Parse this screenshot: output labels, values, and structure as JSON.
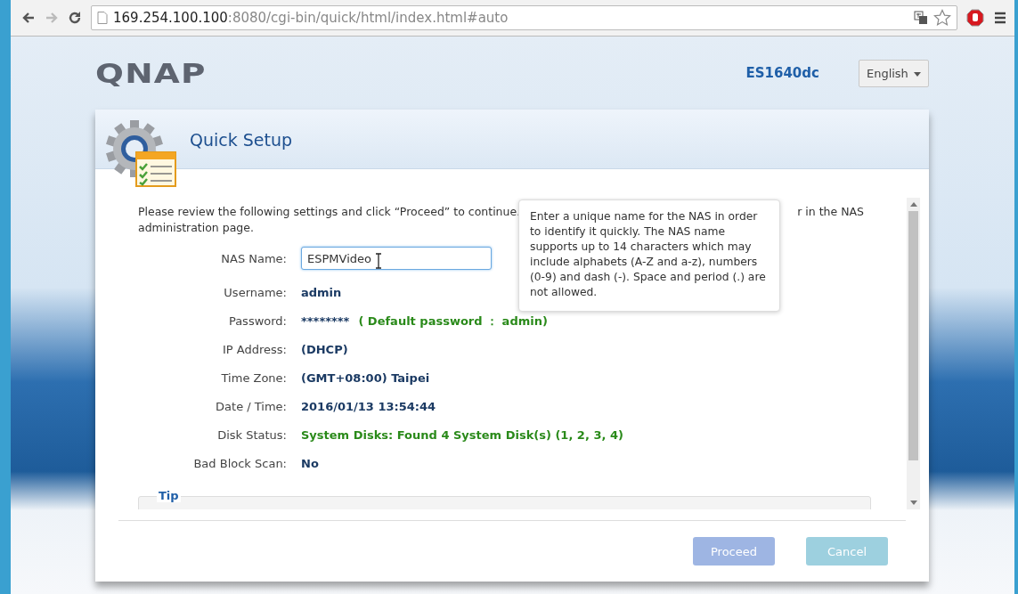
{
  "browser": {
    "url_host": "169.254.100.100",
    "url_rest": ":8080/cgi-bin/quick/html/index.html#auto"
  },
  "header": {
    "logo": "QNAP",
    "model": "ES1640dc",
    "language": "English"
  },
  "dialog": {
    "title": "Quick Setup",
    "intro": "Please review the following settings and click “Proceed” to continue.",
    "intro_tail": "r in the NAS",
    "intro_line2": "administration page.",
    "fields": [
      {
        "kind": "input",
        "label": "NAS Name:",
        "value": "ESPMVideo"
      },
      {
        "kind": "value",
        "label": "Username:",
        "value": "admin"
      },
      {
        "kind": "value",
        "label": "Password:",
        "value": "********",
        "note": "( Default password ： admin)"
      },
      {
        "kind": "value",
        "label": "IP Address:",
        "value": "(DHCP)"
      },
      {
        "kind": "value",
        "label": "Time Zone:",
        "value": "(GMT+08:00) Taipei"
      },
      {
        "kind": "value",
        "label": "Date / Time:",
        "value": "2016/01/13 13:54:44"
      },
      {
        "kind": "success",
        "label": "Disk Status:",
        "value": "System Disks: Found 4 System Disk(s) (1, 2, 3, 4)"
      },
      {
        "kind": "value",
        "label": "Bad Block Scan:",
        "value": "No"
      }
    ],
    "tip": {
      "legend": "Tip"
    },
    "tooltip": "Enter a unique name for the NAS in order to identify it quickly. The NAS name supports up to 14 characters which may include alphabets (A-Z and a-z), numbers (0-9) and dash (-). Space and period (.) are not allowed.",
    "buttons": [
      {
        "kind": "primary",
        "label": "Proceed",
        "disabled": true
      },
      {
        "kind": "secondary",
        "label": "Cancel",
        "disabled": true
      }
    ]
  }
}
